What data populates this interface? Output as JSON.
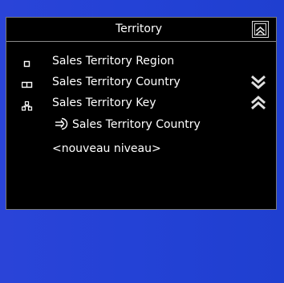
{
  "panel": {
    "title": "Territory",
    "levels": [
      {
        "label": "Sales Territory Region",
        "icon": "level-small-icon"
      },
      {
        "label": "Sales Territory Country",
        "icon": "level-medium-icon"
      },
      {
        "label": "Sales Territory Key",
        "icon": "level-tree-icon"
      }
    ],
    "attribute": {
      "label": "Sales Territory Country",
      "icon": "attribute-arrow-icon"
    },
    "new_level": "<nouveau niveau>"
  },
  "colors": {
    "background": "#2442d6",
    "panel": "#000000",
    "text": "#ffffff",
    "border": "#7a7a7a"
  }
}
